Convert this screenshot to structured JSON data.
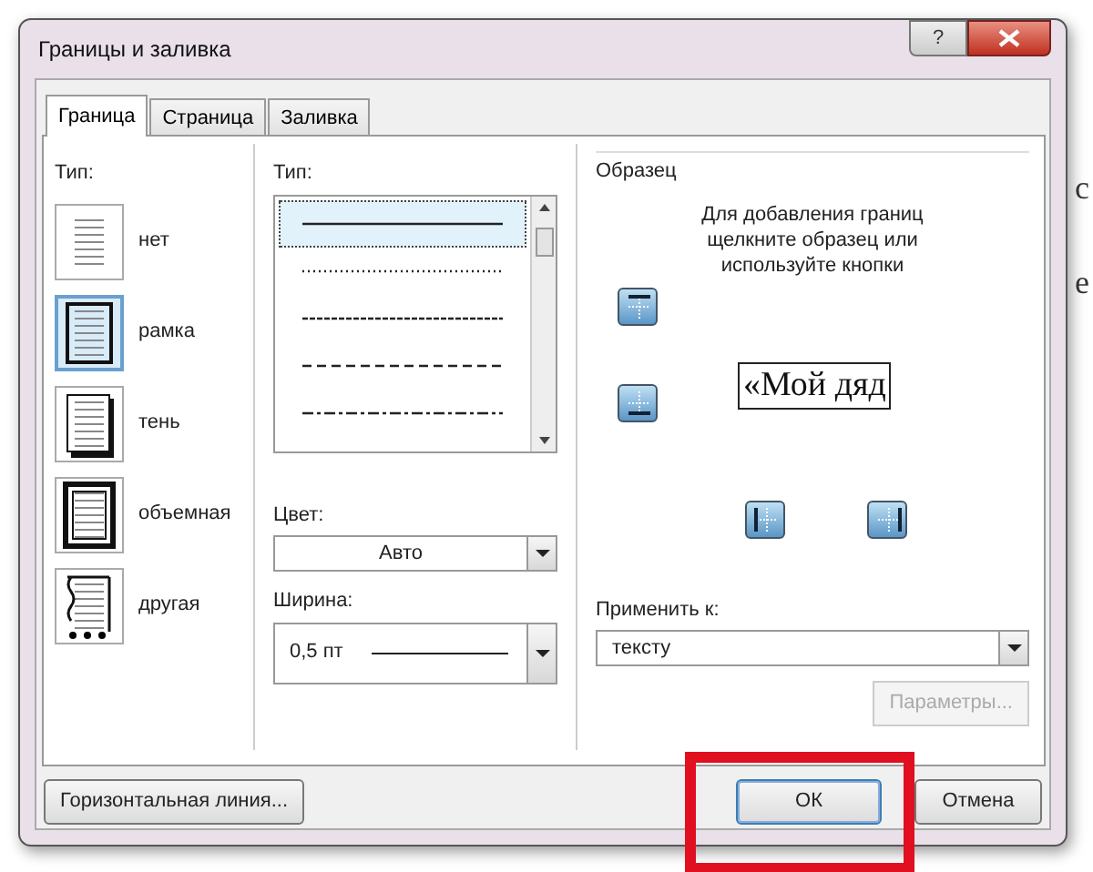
{
  "window": {
    "title": "Границы и заливка",
    "help_button": "?"
  },
  "tabs": [
    {
      "label": "Граница",
      "selected": true
    },
    {
      "label": "Страница",
      "selected": false
    },
    {
      "label": "Заливка",
      "selected": false
    }
  ],
  "setting": {
    "label": "Тип:",
    "items": [
      {
        "kind": "none",
        "label": "нет",
        "selected": false
      },
      {
        "kind": "box",
        "label": "рамка",
        "selected": true
      },
      {
        "kind": "shadow",
        "label": "тень",
        "selected": false
      },
      {
        "kind": "volume",
        "label": "объемная",
        "selected": false
      },
      {
        "kind": "custom",
        "label": "другая",
        "selected": false
      }
    ]
  },
  "style": {
    "label": "Тип:",
    "lines": [
      {
        "kind": "solid",
        "selected": true
      },
      {
        "kind": "dotted",
        "selected": false
      },
      {
        "kind": "dense",
        "selected": false
      },
      {
        "kind": "dashed",
        "selected": false
      },
      {
        "kind": "dashdot",
        "selected": false
      }
    ]
  },
  "color": {
    "label": "Цвет:",
    "value": "Авто"
  },
  "width": {
    "label": "Ширина:",
    "value": "0,5 пт"
  },
  "preview": {
    "label": "Образец",
    "hint": "Для добавления границ щелкните образец или используйте кнопки",
    "sample": "«Мой дяд",
    "buttons": [
      {
        "kind": "top"
      },
      {
        "kind": "bottom"
      },
      {
        "kind": "left"
      },
      {
        "kind": "right"
      }
    ]
  },
  "apply_to": {
    "label": "Применить к:",
    "value": "тексту"
  },
  "options_button": {
    "label": "Параметры...",
    "disabled": true
  },
  "buttons": [
    {
      "kind": "horizontal",
      "label": "Горизонтальная линия..."
    },
    {
      "kind": "ok",
      "label": "ОК",
      "highlighted": true
    },
    {
      "kind": "cancel",
      "label": "Отмена"
    }
  ],
  "document_fragments": [
    "с",
    "е"
  ]
}
